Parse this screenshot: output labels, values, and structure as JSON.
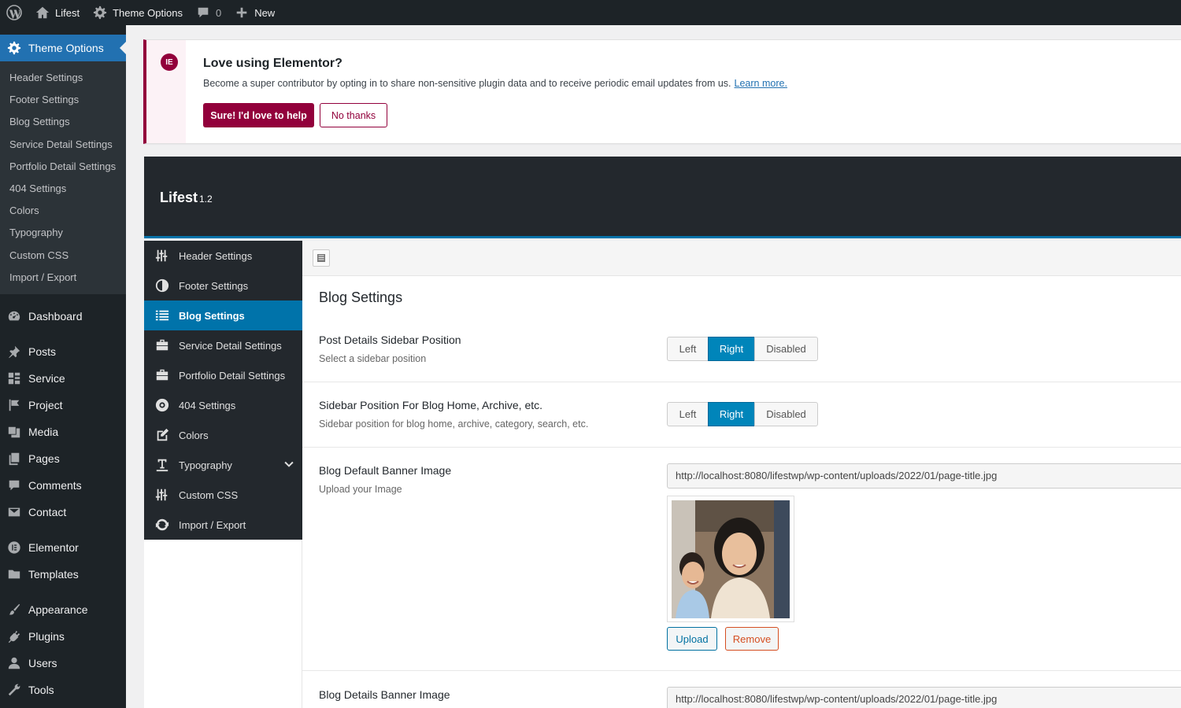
{
  "adminbar": {
    "site_name": "Lifest",
    "theme_options": "Theme Options",
    "comments_count": "0",
    "new_label": "New"
  },
  "menu": {
    "current": "Theme Options",
    "submenu": [
      "Header Settings",
      "Footer Settings",
      "Blog Settings",
      "Service Detail Settings",
      "Portfolio Detail Settings",
      "404 Settings",
      "Colors",
      "Typography",
      "Custom CSS",
      "Import / Export"
    ],
    "items": {
      "dashboard": "Dashboard",
      "posts": "Posts",
      "service": "Service",
      "project": "Project",
      "media": "Media",
      "pages": "Pages",
      "comments": "Comments",
      "contact": "Contact",
      "elementor": "Elementor",
      "templates": "Templates",
      "appearance": "Appearance",
      "plugins": "Plugins",
      "users": "Users",
      "tools": "Tools"
    }
  },
  "notice": {
    "title": "Love using Elementor?",
    "text": "Become a super contributor by opting in to share non-sensitive plugin data and to receive periodic email updates from us.",
    "link": "Learn more.",
    "yes_button": "Sure! I'd love to help",
    "no_button": "No thanks",
    "accent": "#92003b"
  },
  "panel": {
    "theme_name": "Lifest",
    "version": "1.2",
    "accent": "#0073aa",
    "nav": {
      "header": "Header Settings",
      "footer": "Footer Settings",
      "blog": "Blog Settings",
      "service": "Service Detail Settings",
      "portfolio": "Portfolio Detail Settings",
      "notfound": "404 Settings",
      "colors": "Colors",
      "typography": "Typography",
      "css": "Custom CSS",
      "import": "Import / Export"
    },
    "section_title": "Blog Settings",
    "fields": {
      "post_sidebar": {
        "label": "Post Details Sidebar Position",
        "desc": "Select a sidebar position",
        "options": {
          "left": "Left",
          "right": "Right",
          "disabled": "Disabled"
        },
        "selected": "Right"
      },
      "blog_sidebar": {
        "label": "Sidebar Position For Blog Home, Archive, etc.",
        "desc": "Sidebar position for blog home, archive, category, search, etc.",
        "options": {
          "left": "Left",
          "right": "Right",
          "disabled": "Disabled"
        },
        "selected": "Right"
      },
      "default_banner": {
        "label": "Blog Default Banner Image",
        "desc": "Upload your Image",
        "url": "http://localhost:8080/lifestwp/wp-content/uploads/2022/01/page-title.jpg",
        "upload": "Upload",
        "remove": "Remove"
      },
      "details_banner": {
        "label": "Blog Details Banner Image",
        "url": "http://localhost:8080/lifestwp/wp-content/uploads/2022/01/page-title.jpg"
      }
    }
  }
}
